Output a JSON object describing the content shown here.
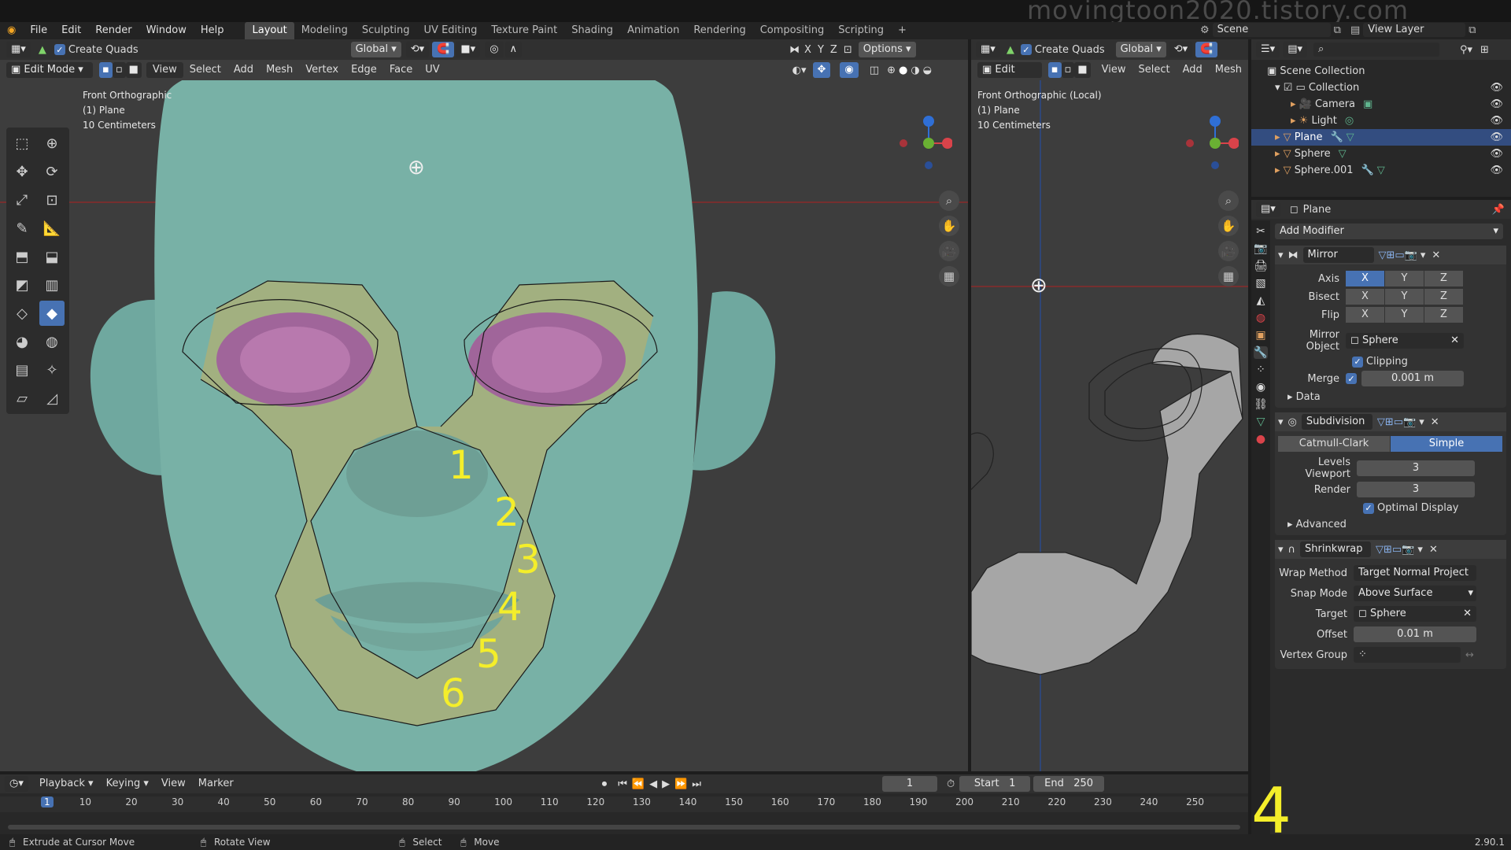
{
  "watermark": "movingtoon2020.tistory.com",
  "topbar": {
    "menus": [
      "File",
      "Edit",
      "Render",
      "Window",
      "Help"
    ],
    "workspaces": [
      "Layout",
      "Modeling",
      "Sculpting",
      "UV Editing",
      "Texture Paint",
      "Shading",
      "Animation",
      "Rendering",
      "Compositing",
      "Scripting"
    ],
    "active_workspace": "Layout",
    "add_workspace": "+",
    "scene": "Scene",
    "view_layer": "View Layer"
  },
  "left_viewport": {
    "create_quads": "Create Quads",
    "orientation": "Global",
    "axes": [
      "X",
      "Y",
      "Z"
    ],
    "options": "Options",
    "mode": "Edit Mode",
    "menus": [
      "View",
      "Select",
      "Add",
      "Mesh",
      "Vertex",
      "Edge",
      "Face",
      "UV"
    ],
    "overlay": [
      "Front Orthographic",
      "(1) Plane",
      "10 Centimeters"
    ],
    "annotations": [
      "1",
      "2",
      "3",
      "4",
      "5",
      "6"
    ]
  },
  "right_viewport": {
    "create_quads": "Create Quads",
    "orientation": "Global",
    "mode": "Edit Mode",
    "menus": [
      "View",
      "Select",
      "Add",
      "Mesh"
    ],
    "overlay": [
      "Front Orthographic (Local)",
      "(1) Plane",
      "10 Centimeters"
    ]
  },
  "outliner": {
    "items": [
      {
        "label": "Scene Collection",
        "indent": 0
      },
      {
        "label": "Collection",
        "indent": 1
      },
      {
        "label": "Camera",
        "indent": 2
      },
      {
        "label": "Light",
        "indent": 2
      },
      {
        "label": "Plane",
        "indent": 1,
        "selected": true
      },
      {
        "label": "Sphere",
        "indent": 1
      },
      {
        "label": "Sphere.001",
        "indent": 1
      }
    ]
  },
  "properties": {
    "object_name": "Plane",
    "add_modifier": "Add Modifier",
    "mirror": {
      "name": "Mirror",
      "axis_label": "Axis",
      "bisect_label": "Bisect",
      "flip_label": "Flip",
      "xyz": [
        "X",
        "Y",
        "Z"
      ],
      "mirror_object_label": "Mirror Object",
      "mirror_object": "Sphere",
      "clipping": "Clipping",
      "merge_label": "Merge",
      "merge_value": "0.001 m",
      "data": "Data"
    },
    "subdivision": {
      "name": "Subdivision",
      "catmull": "Catmull-Clark",
      "simple": "Simple",
      "levels_label": "Levels Viewport",
      "levels_value": "3",
      "render_label": "Render",
      "render_value": "3",
      "optimal": "Optimal Display",
      "advanced": "Advanced"
    },
    "shrinkwrap": {
      "name": "Shrinkwrap",
      "wrap_label": "Wrap Method",
      "wrap_value": "Target Normal Project",
      "snap_label": "Snap Mode",
      "snap_value": "Above Surface",
      "target_label": "Target",
      "target_value": "Sphere",
      "offset_label": "Offset",
      "offset_value": "0.01 m",
      "vgroup_label": "Vertex Group"
    }
  },
  "timeline": {
    "menus": [
      "Playback",
      "Keying",
      "View",
      "Marker"
    ],
    "current_frame": "1",
    "start_label": "Start",
    "start": "1",
    "end_label": "End",
    "end": "250",
    "ticks": [
      "1",
      "10",
      "20",
      "30",
      "40",
      "50",
      "60",
      "70",
      "80",
      "90",
      "100",
      "110",
      "120",
      "130",
      "140",
      "150",
      "160",
      "170",
      "180",
      "190",
      "200",
      "210",
      "220",
      "230",
      "240",
      "250"
    ]
  },
  "big_annotation": "4",
  "status": {
    "extrude": "Extrude at Cursor Move",
    "rotate": "Rotate View",
    "select": "Select",
    "move": "Move",
    "version": "2.90.1"
  }
}
